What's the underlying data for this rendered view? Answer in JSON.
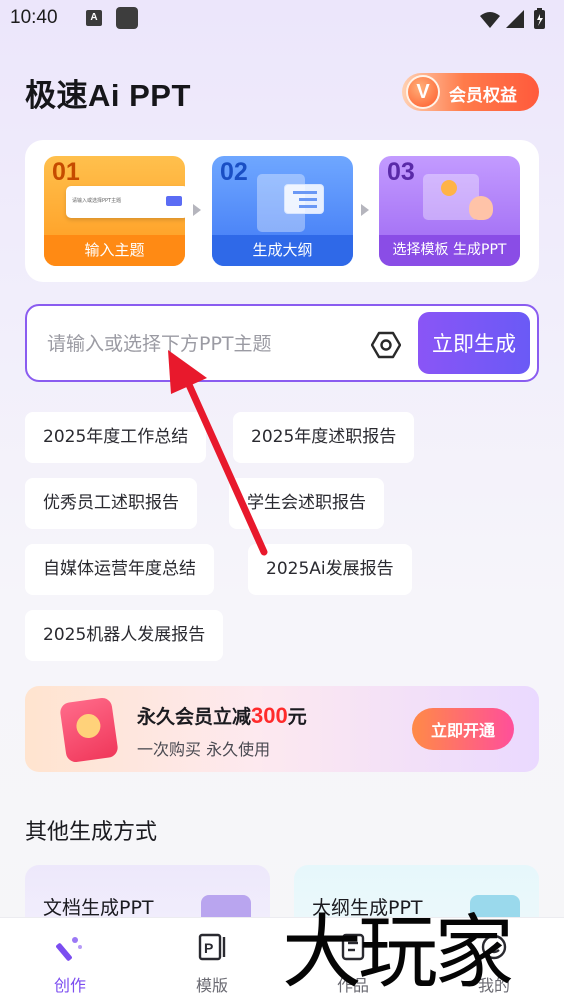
{
  "status_bar": {
    "time": "10:40",
    "notif_a": "A"
  },
  "header": {
    "title": "极速Ai PPT",
    "vip_label": "会员权益",
    "vip_glyph": "V"
  },
  "steps": [
    {
      "num": "01",
      "label": "输入主题",
      "mock_input": "请输入或选择PPT主题"
    },
    {
      "num": "02",
      "label": "生成大纲"
    },
    {
      "num": "03",
      "label": "选择模板 生成PPT"
    }
  ],
  "input": {
    "placeholder": "请输入或选择下方PPT主题",
    "value": "",
    "generate_label": "立即生成"
  },
  "chips": [
    "2025年度工作总结",
    "2025年度述职报告",
    "优秀员工述职报告",
    "学生会述职报告",
    "自媒体运营年度总结",
    "2025Ai发展报告",
    "2025机器人发展报告"
  ],
  "promo": {
    "title_prefix": "永久会员立减",
    "amount": "300",
    "unit": "元",
    "subtitle": "一次购买 永久使用",
    "button": "立即开通"
  },
  "other_methods": {
    "title": "其他生成方式",
    "items": [
      "文档生成PPT",
      "大纲生成PPT"
    ]
  },
  "bottom_nav": [
    {
      "label": "创作",
      "active": true,
      "icon": "magic-wand-icon"
    },
    {
      "label": "模版",
      "active": false,
      "icon": "ppt-template-icon"
    },
    {
      "label": "作品",
      "active": false,
      "icon": "document-icon"
    },
    {
      "label": "我的",
      "active": false,
      "icon": "profile-icon"
    }
  ],
  "watermark": "大玩家",
  "colors": {
    "accent": "#7b4df0",
    "input_border": "#8a5cf0",
    "arrow": "#e8192c",
    "promo_amount": "#ff2b2b"
  }
}
